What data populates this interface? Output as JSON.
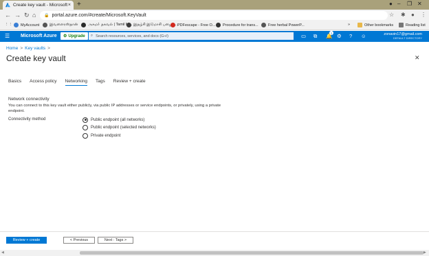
{
  "browser": {
    "tab_title": "Create key vault - Microsoft Azu",
    "tab_close": "×",
    "new_tab": "+",
    "url": "portal.azure.com/#create/Microsoft.KeyVault",
    "bookmarks": [
      {
        "label": "MyAccount",
        "color": "#3a7fd5"
      },
      {
        "label": "இவளைரஸ்தான்",
        "color": "#555"
      },
      {
        "label": "அகமா் தகவல் | Tamil M...",
        "color": "#2a2a2a"
      },
      {
        "label": "இதழ்சி இடுமாசி பழைய...",
        "color": "#3b3b3b"
      },
      {
        "label": "PDFescape - Free O...",
        "color": "#d42a1f"
      },
      {
        "label": "Procedure for trans...",
        "color": "#333"
      },
      {
        "label": "Free herbal PowerP...",
        "color": "#555"
      }
    ],
    "other_bookmarks": "Other bookmarks",
    "reading_list": "Reading list"
  },
  "azure": {
    "brand": "Microsoft Azure",
    "upgrade": "Upgrade",
    "search_placeholder": "Search resources, services, and docs (G+/)",
    "notification_count": "1",
    "user_email": "zonavin17@gmail.com",
    "user_directory": "DEFAULT DIRECTORY"
  },
  "breadcrumb": {
    "home": "Home",
    "sep": ">",
    "current": "Key vaults",
    "end": ">"
  },
  "page_title": "Create key vault",
  "tabs": [
    "Basics",
    "Access policy",
    "Networking",
    "Tags",
    "Review + create"
  ],
  "active_tab": "Networking",
  "networking": {
    "section_title": "Network connectivity",
    "description": "You can connect to this key vault either publicly, via public IP addresses or service endpoints, or privately, using a private endpoint.",
    "label": "Connectivity method",
    "options": [
      {
        "label": "Public endpoint (all networks)",
        "selected": true
      },
      {
        "label": "Public endpoint (selected networks)",
        "selected": false
      },
      {
        "label": "Private endpoint",
        "selected": false
      }
    ]
  },
  "footer": {
    "review_create": "Review + create",
    "previous": "< Previous",
    "next": "Next : Tags >"
  },
  "colors": {
    "accent": "#0078d4",
    "titlebar": "#a9a17b",
    "upgrade_green": "#107c10"
  }
}
